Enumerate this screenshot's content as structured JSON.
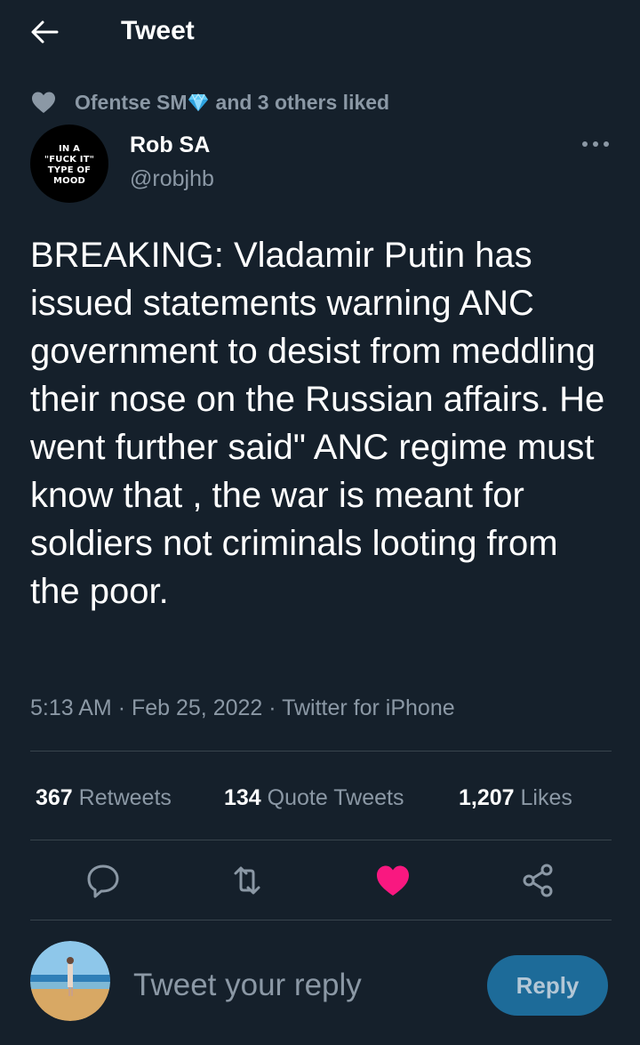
{
  "header": {
    "title": "Tweet",
    "back_icon": "arrow-left-icon"
  },
  "social_context": {
    "liker": "Ofentse SM",
    "rest": "and 3 others liked",
    "icon": "heart-icon",
    "badge_icon": "diamond-icon"
  },
  "author": {
    "name": "Rob SA",
    "handle": "@robjhb",
    "avatar_lines": [
      "IN A",
      "\"FUCK IT\"",
      "TYPE OF",
      "MOOD"
    ]
  },
  "tweet": {
    "text": "BREAKING: Vladamir Putin has issued statements warning ANC government to desist from meddling their nose on the Russian affairs. He went further said\" ANC regime must know that , the war is meant for soldiers not criminals looting from the poor.",
    "time": "5:13 AM",
    "date": "Feb 25, 2022",
    "source": "Twitter for iPhone",
    "separator": "·"
  },
  "stats": {
    "retweets_count": "367",
    "retweets_label": "Retweets",
    "quotes_count": "134",
    "quotes_label": "Quote Tweets",
    "likes_count": "1,207",
    "likes_label": "Likes"
  },
  "actions": [
    "reply-icon",
    "retweet-icon",
    "like-icon",
    "share-icon"
  ],
  "reply": {
    "placeholder": "Tweet your reply",
    "button": "Reply"
  },
  "colors": {
    "background": "#15202b",
    "secondary_text": "#8b98a5",
    "divider": "#38444d",
    "like": "#f91880",
    "reply_button": "#1d6b99"
  }
}
